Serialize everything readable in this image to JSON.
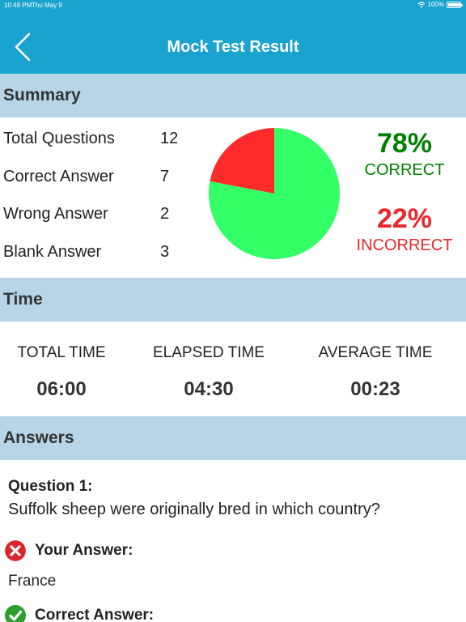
{
  "status_bar": {
    "time": "10:48 PM",
    "date": "Thu May 9",
    "battery_text": "100%",
    "battery_level": 1.0
  },
  "nav": {
    "title": "Mock Test Result",
    "back_icon": "chevron-left-icon"
  },
  "summary": {
    "header": "Summary",
    "rows": [
      {
        "label": "Total Questions",
        "value": "12"
      },
      {
        "label": "Correct Answer",
        "value": "7"
      },
      {
        "label": "Wrong Answer",
        "value": "2"
      },
      {
        "label": "Blank Answer",
        "value": "3"
      }
    ],
    "correct_percent": "78%",
    "correct_label": "CORRECT",
    "incorrect_percent": "22%",
    "incorrect_label": "INCORRECT",
    "colors": {
      "correct": "#008000",
      "incorrect": "#e8282b",
      "pie_correct": "#33ff66",
      "pie_incorrect": "#ff2a2a"
    }
  },
  "chart_data": {
    "type": "pie",
    "categories": [
      "Correct",
      "Incorrect"
    ],
    "values": [
      78,
      22
    ],
    "title": ""
  },
  "time": {
    "header": "Time",
    "columns": [
      {
        "label": "TOTAL TIME",
        "value": "06:00"
      },
      {
        "label": "ELAPSED TIME",
        "value": "04:30"
      },
      {
        "label": "AVERAGE TIME",
        "value": "00:23"
      }
    ]
  },
  "answers": {
    "header": "Answers",
    "question_title": "Question 1:",
    "question_text": "Suffolk sheep were originally bred in which country?",
    "your_answer_label": "Your Answer:",
    "your_answer_value": "France",
    "correct_answer_label": "Correct Answer:"
  },
  "theme": {
    "primary": "#1aa3cf",
    "section_bg": "#b7d5e6"
  }
}
